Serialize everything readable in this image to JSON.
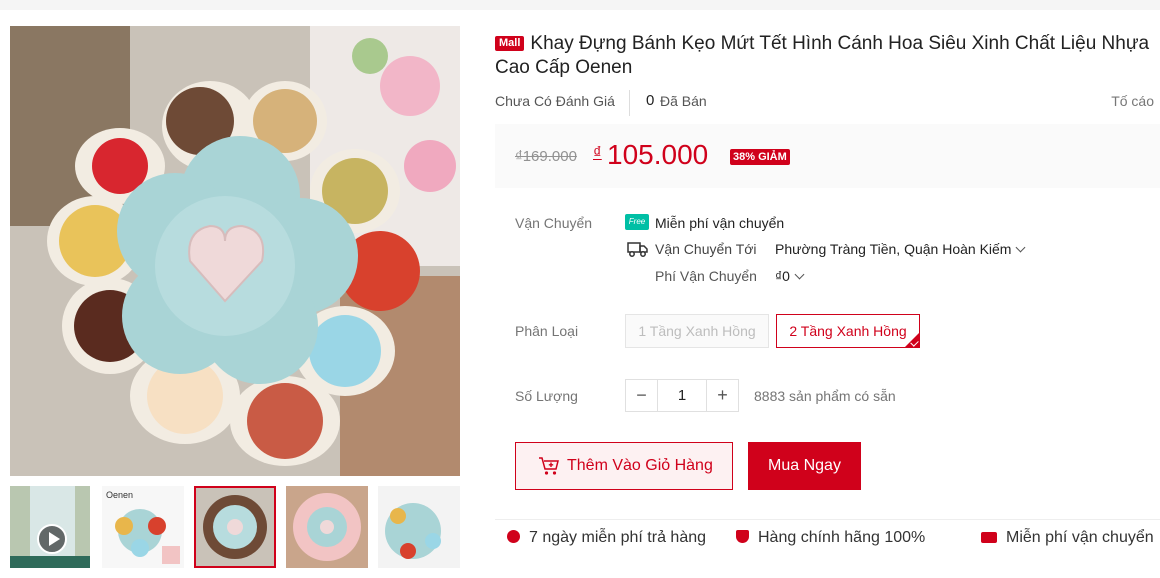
{
  "product": {
    "mall_badge": "Mall",
    "title": "Khay Đựng Bánh Kẹo Mứt Tết Hình Cánh Hoa Siêu Xinh Chất Liệu Nhựa Cao Cấp Oenen"
  },
  "rating": {
    "no_rating": "Chưa Có Đánh Giá",
    "sold_count": "0",
    "sold_label": "Đã Bán",
    "report": "Tố cáo"
  },
  "price": {
    "original": "₫169.000",
    "currency": "₫",
    "current": "105.000",
    "discount": "38% GIẢM"
  },
  "shipping": {
    "label": "Vận Chuyển",
    "free_tag": "Free",
    "free_text": "Miễn phí vận chuyển",
    "to_label": "Vận Chuyển Tới",
    "to_value": "Phường Tràng Tiền, Quận Hoàn Kiếm",
    "fee_label": "Phí Vận Chuyển",
    "fee_value": "₫0"
  },
  "variation": {
    "label": "Phân Loại",
    "options": [
      "1 Tầng Xanh Hồng",
      "2 Tầng Xanh Hồng"
    ],
    "selected": "2 Tầng Xanh Hồng"
  },
  "quantity": {
    "label": "Số Lượng",
    "minus": "−",
    "value": "1",
    "plus": "+",
    "stock": "8883 sản phẩm có sẵn"
  },
  "actions": {
    "add_to_cart": "Thêm Vào Giỏ Hàng",
    "buy_now": "Mua Ngay"
  },
  "guarantees": [
    "7 ngày miễn phí trả hàng",
    "Hàng chính hãng 100%",
    "Miễn phí vận chuyển"
  ],
  "gallery": {
    "thumb_brand_text": "Oenen",
    "colors": {
      "accent": "#d0011b",
      "tray": "#a9d4d6",
      "tray_pink": "#f2c4c4"
    }
  }
}
